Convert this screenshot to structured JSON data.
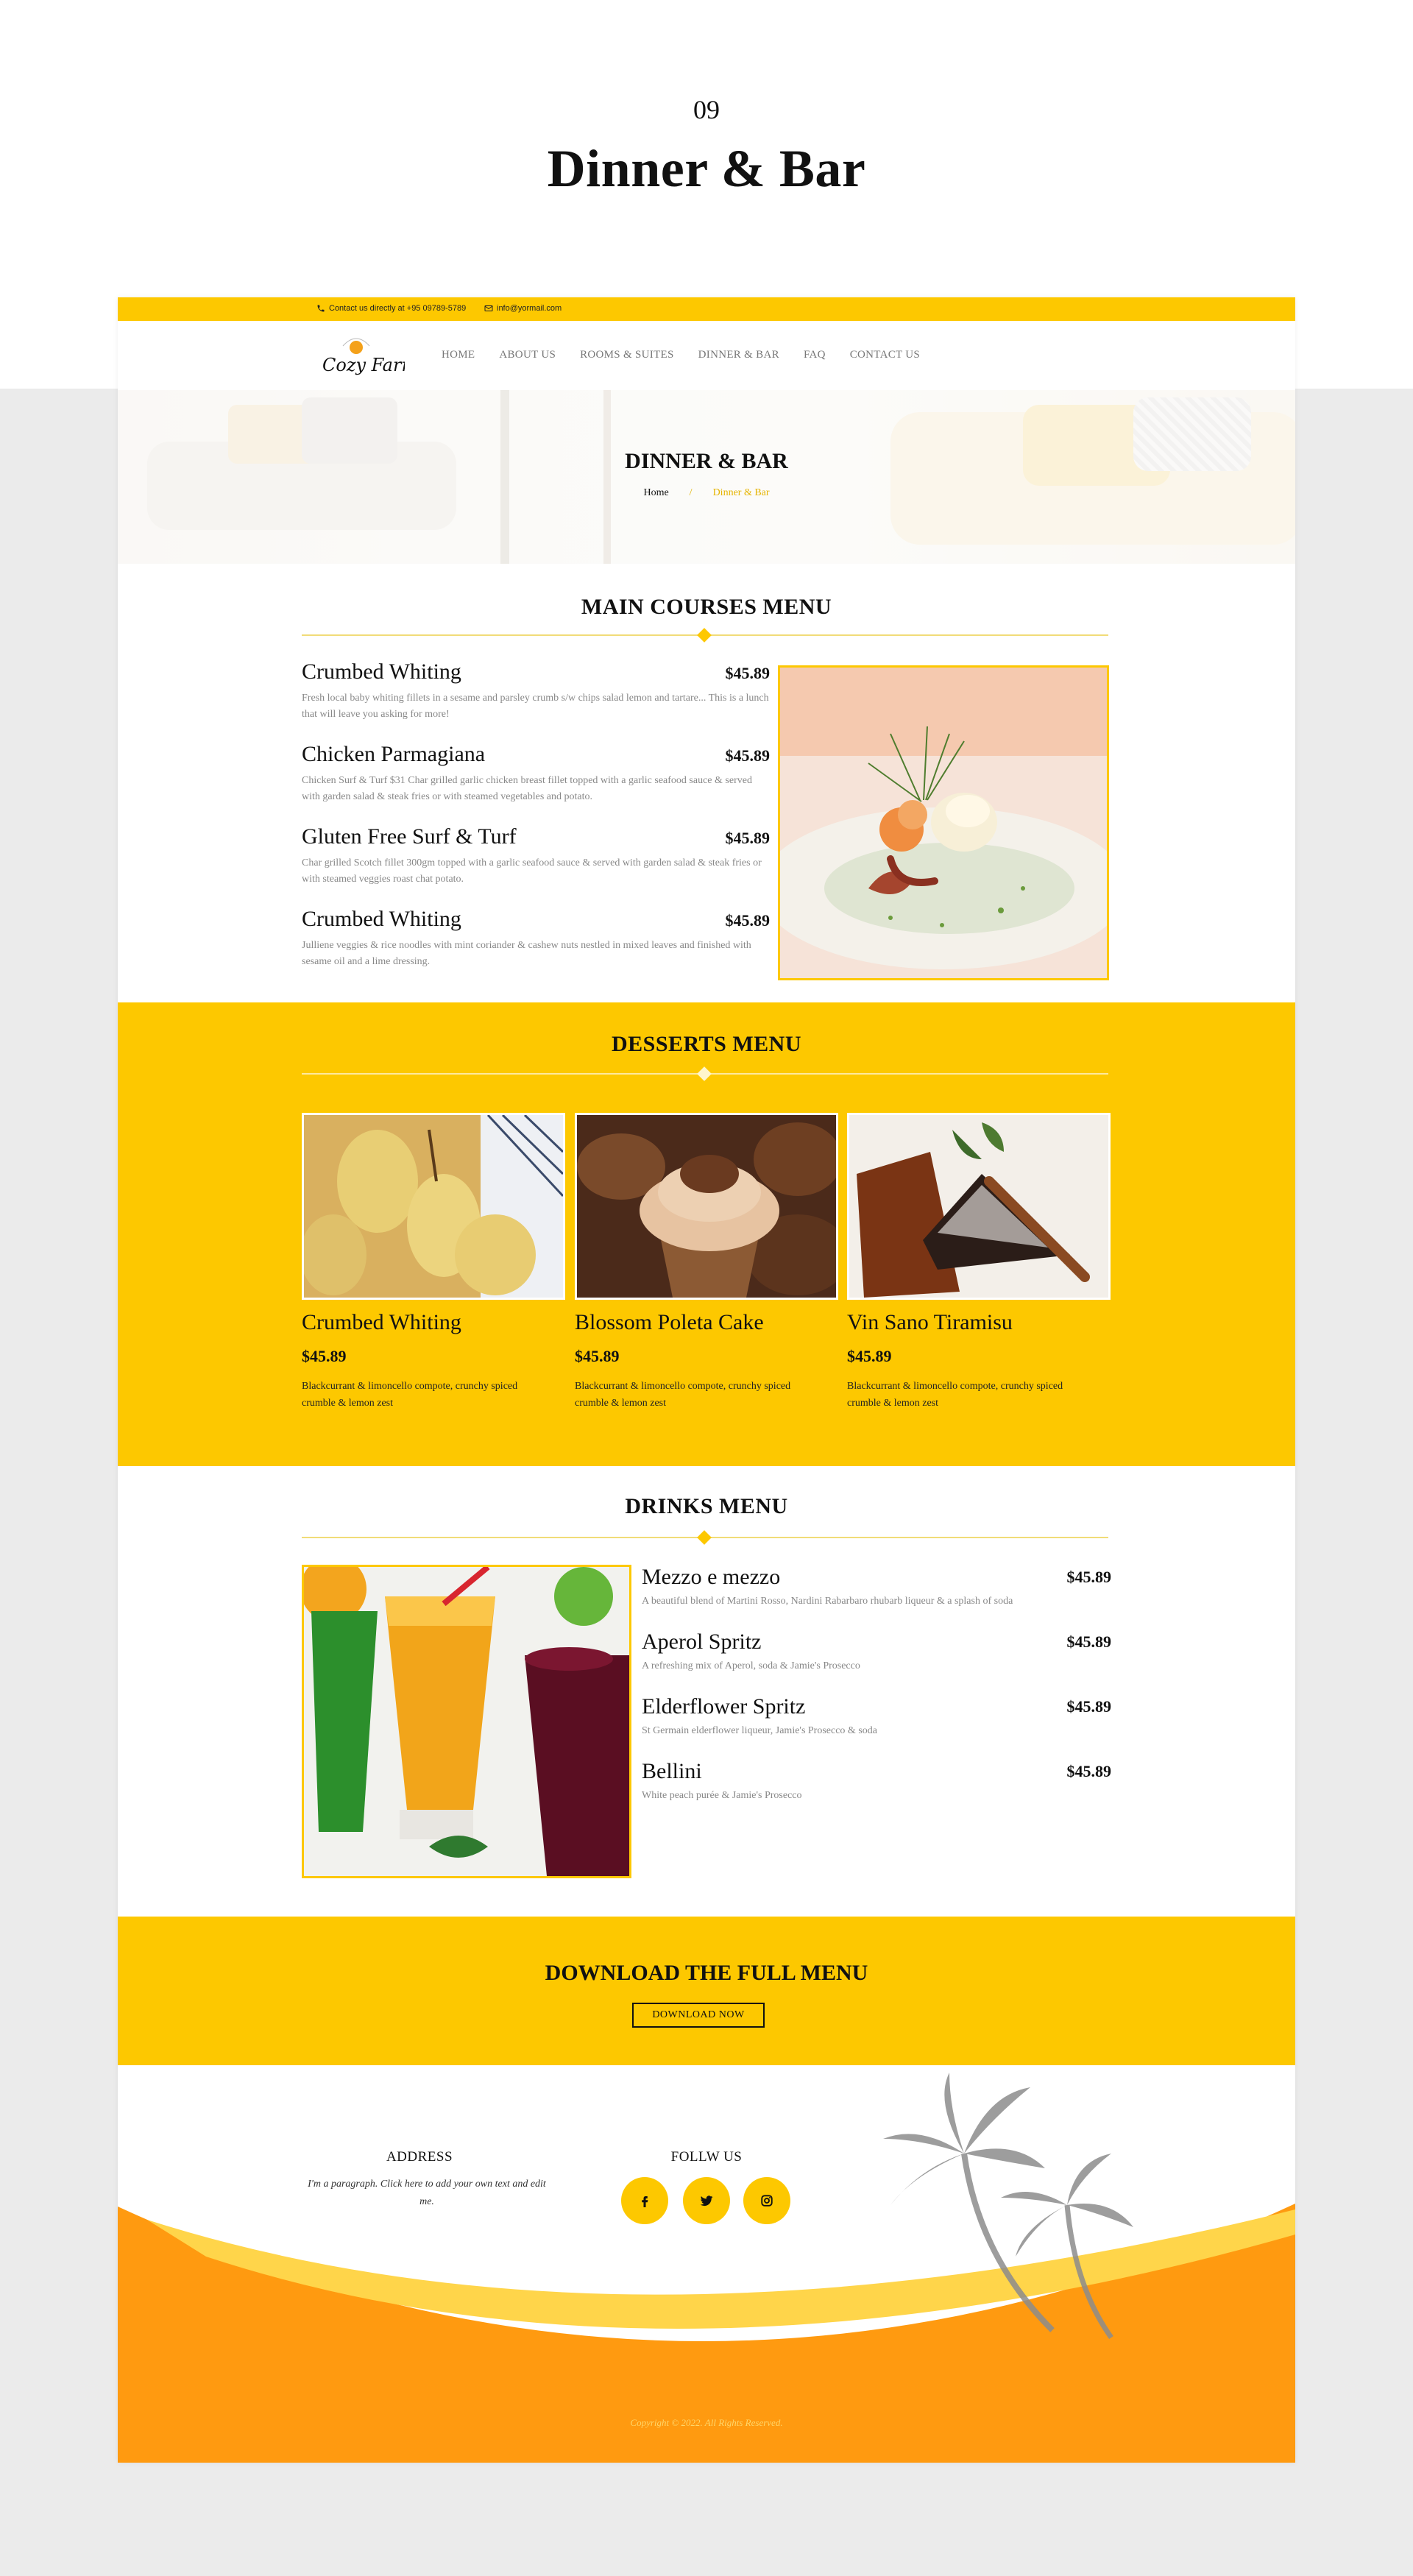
{
  "presentation": {
    "number": "09",
    "title": "Dinner & Bar"
  },
  "topbar": {
    "phone_text": "Contact us directly at +95 09789-5789",
    "email_text": "info@yormail.com"
  },
  "nav": {
    "logo_text": "Cozy Farm",
    "items": [
      "HOME",
      "ABOUT US",
      "ROOMS & SUITES",
      "DINNER & BAR",
      "FAQ",
      "CONTACT US"
    ]
  },
  "hero": {
    "title": "DINNER & BAR",
    "breadcrumb": {
      "home": "Home",
      "separator": "/",
      "current": "Dinner & Bar"
    }
  },
  "main_courses": {
    "title": "MAIN COURSES MENU",
    "items": [
      {
        "name": "Crumbed Whiting",
        "price": "$45.89",
        "desc": "Fresh local baby whiting fillets in a sesame and parsley crumb s/w chips salad lemon and tartare... This is a lunch that will leave you asking for more!"
      },
      {
        "name": "Chicken Parmagiana",
        "price": "$45.89",
        "desc": "Chicken Surf & Turf $31 Char grilled garlic chicken breast fillet topped with a garlic seafood sauce & served with garden salad & steak fries or with steamed vegetables and potato."
      },
      {
        "name": "Gluten Free Surf & Turf",
        "price": "$45.89",
        "desc": "Char grilled Scotch fillet 300gm topped with a garlic seafood sauce & served with garden salad & steak fries or with steamed veggies roast chat potato."
      },
      {
        "name": "Crumbed Whiting",
        "price": "$45.89",
        "desc": "Julliene veggies & rice noodles with mint coriander & cashew nuts nestled in mixed leaves and finished with sesame oil and a lime dressing."
      }
    ]
  },
  "desserts": {
    "title": "DESSERTS MENU",
    "items": [
      {
        "name": "Crumbed Whiting",
        "price": "$45.89",
        "desc": "Blackcurrant & limoncello compote, crunchy spiced crumble & lemon zest"
      },
      {
        "name": "Blossom Poleta Cake",
        "price": "$45.89",
        "desc": "Blackcurrant & limoncello compote, crunchy spiced crumble & lemon zest"
      },
      {
        "name": "Vin Sano Tiramisu",
        "price": "$45.89",
        "desc": "Blackcurrant & limoncello compote, crunchy spiced crumble & lemon zest"
      }
    ]
  },
  "drinks": {
    "title": "DRINKS MENU",
    "items": [
      {
        "name": "Mezzo e mezzo",
        "price": "$45.89",
        "desc": "A beautiful blend of Martini Rosso, Nardini Rabarbaro rhubarb liqueur & a splash of soda"
      },
      {
        "name": "Aperol Spritz",
        "price": "$45.89",
        "desc": "A refreshing mix of Aperol, soda & Jamie's Prosecco"
      },
      {
        "name": "Elderflower Spritz",
        "price": "$45.89",
        "desc": "St Germain elderflower liqueur, Jamie's Prosecco & soda"
      },
      {
        "name": "Bellini",
        "price": "$45.89",
        "desc": "White peach purée & Jamie's Prosecco"
      }
    ]
  },
  "download": {
    "title": "DOWNLOAD THE FULL MENU",
    "button": "DOWNLOAD NOW"
  },
  "footer": {
    "address_title": "ADDRESS",
    "address_text": "I'm a paragraph. Click here to add your own text and edit me.",
    "follow_title": "FOLLW US",
    "social": [
      "facebook-icon",
      "twitter-icon",
      "instagram-icon"
    ],
    "copyright": "Copyright © 2022. All Rights Reserved."
  },
  "colors": {
    "accent": "#fdc800",
    "footer_orange": "#ff9a10",
    "footer_light": "#ffd54a",
    "muted_text": "#888888"
  }
}
